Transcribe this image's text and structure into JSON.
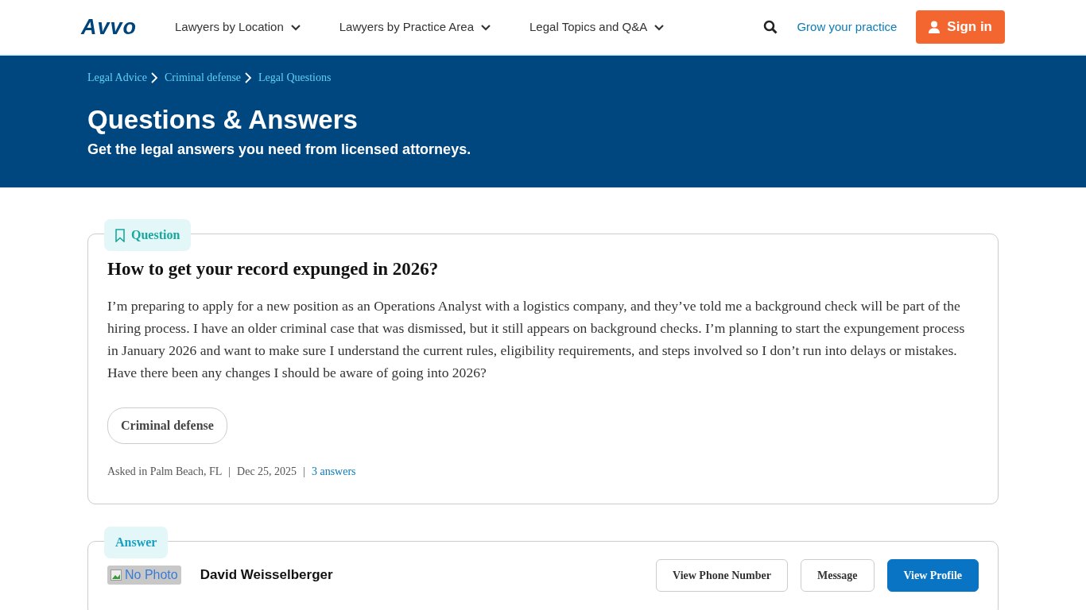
{
  "nav": {
    "logo": "Avvo",
    "menus": [
      {
        "label": "Lawyers by Location"
      },
      {
        "label": "Lawyers by Practice Area"
      },
      {
        "label": "Legal Topics and Q&A"
      }
    ],
    "grow_link": "Grow your practice",
    "sign_in": "Sign in"
  },
  "breadcrumbs": [
    {
      "label": "Legal Advice"
    },
    {
      "label": "Criminal defense"
    },
    {
      "label": "Legal Questions"
    }
  ],
  "hero": {
    "title": "Questions & Answers",
    "subtitle": "Get the legal answers you need from licensed attorneys."
  },
  "question": {
    "label": "Question",
    "title": "How to get your record expunged in 2026?",
    "body": "I’m preparing to apply for a new position as an Operations Analyst with a logistics company, and they’ve told me a background check will be part of the hiring process. I have an older criminal case that was dismissed, but it still appears on background checks. I’m planning to start the expungement process in January 2026 and want to make sure I understand the current rules, eligibility requirements, and steps involved so I don’t run into delays or mistakes. Have there been any changes I should be aware of going into 2026?",
    "tags": [
      "Criminal defense"
    ],
    "meta": [
      {
        "kind": "text",
        "text": "Asked in Palm Beach, FL"
      },
      {
        "kind": "separator",
        "text": "|"
      },
      {
        "kind": "text",
        "text": "Dec 25, 2025"
      },
      {
        "kind": "separator",
        "text": "|"
      },
      {
        "kind": "link",
        "text": "3 answers"
      }
    ]
  },
  "answer": {
    "label": "Answer",
    "photo_alt": "No Photo",
    "lawyer_name": "David Weisselberger",
    "buttons": [
      {
        "label": "View Phone Number",
        "kind": "outline"
      },
      {
        "label": "Message",
        "kind": "outline"
      },
      {
        "label": "View Profile",
        "kind": "primary"
      }
    ]
  }
}
